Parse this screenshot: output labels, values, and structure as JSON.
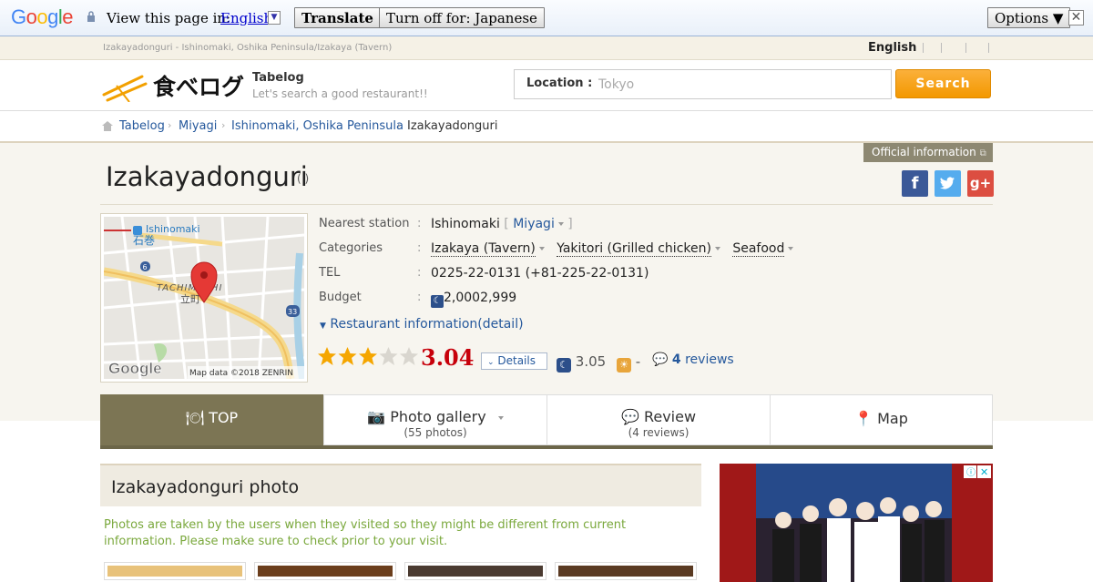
{
  "translate_bar": {
    "logo": "Google",
    "view_text": "View this page in:",
    "language": "English",
    "translate_btn": "Translate",
    "turnoff_btn": "Turn off for: Japanese",
    "options_btn": "Options ▼",
    "close": "✕"
  },
  "top_strip": {
    "crumb": "Izakayadonguri - Ishinomaki, Oshika Peninsula/Izakaya (Tavern)",
    "language": "English"
  },
  "header": {
    "site_name": "Tabelog",
    "tagline": "Let's search a good restaurant!!",
    "location_label": "Location :",
    "location_placeholder": "Tokyo",
    "search_btn": "Search",
    "logo_text": "食べログ"
  },
  "breadcrumb": [
    "Tabelog",
    "Miyagi",
    "Ishinomaki, Oshika Peninsula",
    "Izakayadonguri"
  ],
  "restaurant": {
    "official_btn": "Official information",
    "name": "Izakayadonguri",
    "name_sub": "( )",
    "map": {
      "station_en": "Ishinomaki",
      "station_ja": "石巻",
      "area_en": "TACHIMACHI",
      "area_ja": "立町",
      "route_a": "6",
      "route_b": "33",
      "google": "Google",
      "credit": "Map data ©2018 ZENRIN"
    },
    "info": {
      "station_label": "Nearest station",
      "station": "Ishinomaki",
      "station_pref": "Miyagi",
      "cat_label": "Categories",
      "categories": [
        "Izakaya (Tavern)",
        "Yakitori (Grilled chicken)",
        "Seafood"
      ],
      "tel_label": "TEL",
      "tel": "0225-22-0131 (+81-225-22-0131)",
      "budget_label": "Budget",
      "budget": "2,0002,999",
      "colon": ":"
    },
    "detail_link": "Restaurant information(detail)",
    "rating": {
      "score": "3.04",
      "stars_value": 3.04,
      "stars_max": 5,
      "details_btn": "Details",
      "dinner_score": "3.05",
      "lunch_score": "-",
      "review_count": "4",
      "review_word": "reviews"
    }
  },
  "tabs": [
    {
      "label": "TOP",
      "sub": ""
    },
    {
      "label": "Photo gallery",
      "sub": "(55 photos)"
    },
    {
      "label": "Review",
      "sub": "(4 reviews)"
    },
    {
      "label": "Map",
      "sub": ""
    }
  ],
  "photo_section": {
    "title": "Izakayadonguri photo",
    "note": "Photos are taken by the users when they visited so they might be different from current information. Please make sure to check prior to your visit."
  },
  "colors": {
    "accent": "#f39800",
    "link": "#25589c",
    "score": "#c7000b",
    "tab_active": "#7c7554",
    "note": "#7aa83c"
  }
}
